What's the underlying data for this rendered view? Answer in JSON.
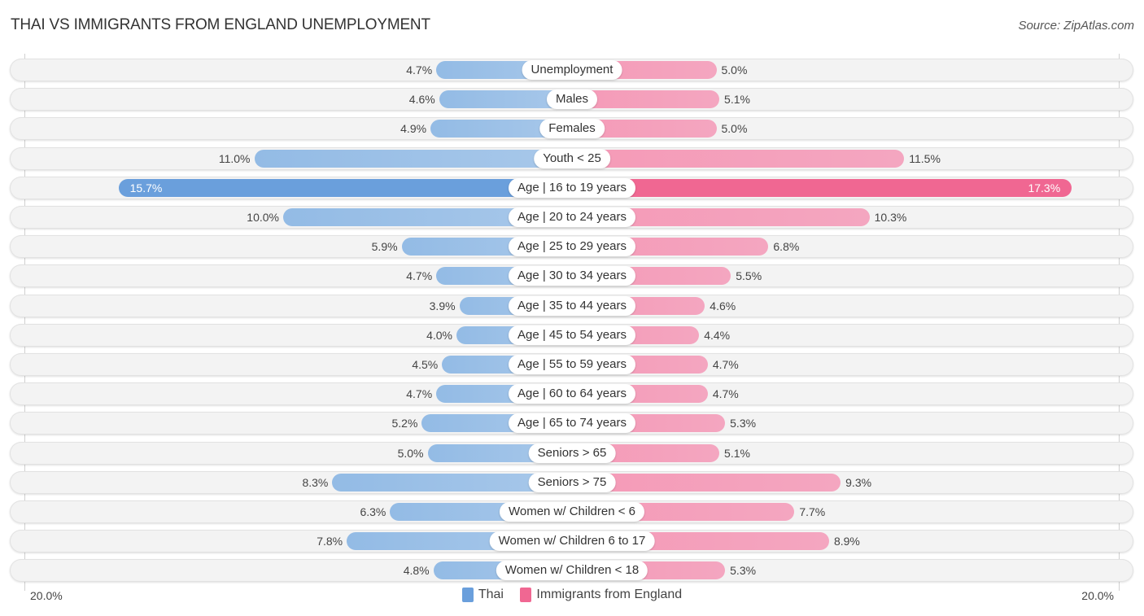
{
  "header": {
    "title": "THAI VS IMMIGRANTS FROM ENGLAND UNEMPLOYMENT",
    "source": "Source: ZipAtlas.com"
  },
  "colors": {
    "thai": "#6a9fdc",
    "thai_light": "#a8c8ea",
    "england": "#f06792",
    "england_light": "#f4a6c0",
    "row_bg": "#f3f3f3"
  },
  "chart_data": {
    "type": "bar",
    "orientation": "horizontal-diverging",
    "title": "THAI VS IMMIGRANTS FROM ENGLAND UNEMPLOYMENT",
    "xlabel": "",
    "ylabel": "",
    "xlim": [
      -20,
      20
    ],
    "axis_labels": {
      "left": "20.0%",
      "right": "20.0%"
    },
    "legend": {
      "position": "bottom-center",
      "entries": [
        "Thai",
        "Immigrants from England"
      ]
    },
    "categories": [
      "Unemployment",
      "Males",
      "Females",
      "Youth < 25",
      "Age | 16 to 19 years",
      "Age | 20 to 24 years",
      "Age | 25 to 29 years",
      "Age | 30 to 34 years",
      "Age | 35 to 44 years",
      "Age | 45 to 54 years",
      "Age | 55 to 59 years",
      "Age | 60 to 64 years",
      "Age | 65 to 74 years",
      "Seniors > 65",
      "Seniors > 75",
      "Women w/ Children < 6",
      "Women w/ Children 6 to 17",
      "Women w/ Children < 18"
    ],
    "series": [
      {
        "name": "Thai",
        "side": "left",
        "values": [
          4.7,
          4.6,
          4.9,
          11.0,
          15.7,
          10.0,
          5.9,
          4.7,
          3.9,
          4.0,
          4.5,
          4.7,
          5.2,
          5.0,
          8.3,
          6.3,
          7.8,
          4.8
        ],
        "labels": [
          "4.7%",
          "4.6%",
          "4.9%",
          "11.0%",
          "15.7%",
          "10.0%",
          "5.9%",
          "4.7%",
          "3.9%",
          "4.0%",
          "4.5%",
          "4.7%",
          "5.2%",
          "5.0%",
          "8.3%",
          "6.3%",
          "7.8%",
          "4.8%"
        ]
      },
      {
        "name": "Immigrants from England",
        "side": "right",
        "values": [
          5.0,
          5.1,
          5.0,
          11.5,
          17.3,
          10.3,
          6.8,
          5.5,
          4.6,
          4.4,
          4.7,
          4.7,
          5.3,
          5.1,
          9.3,
          7.7,
          8.9,
          5.3
        ],
        "labels": [
          "5.0%",
          "5.1%",
          "5.0%",
          "11.5%",
          "17.3%",
          "10.3%",
          "6.8%",
          "5.5%",
          "4.6%",
          "4.4%",
          "4.7%",
          "4.7%",
          "5.3%",
          "5.1%",
          "9.3%",
          "7.7%",
          "8.9%",
          "5.3%"
        ]
      }
    ],
    "highlighted_category": "Age | 16 to 19 years",
    "grid": false
  }
}
